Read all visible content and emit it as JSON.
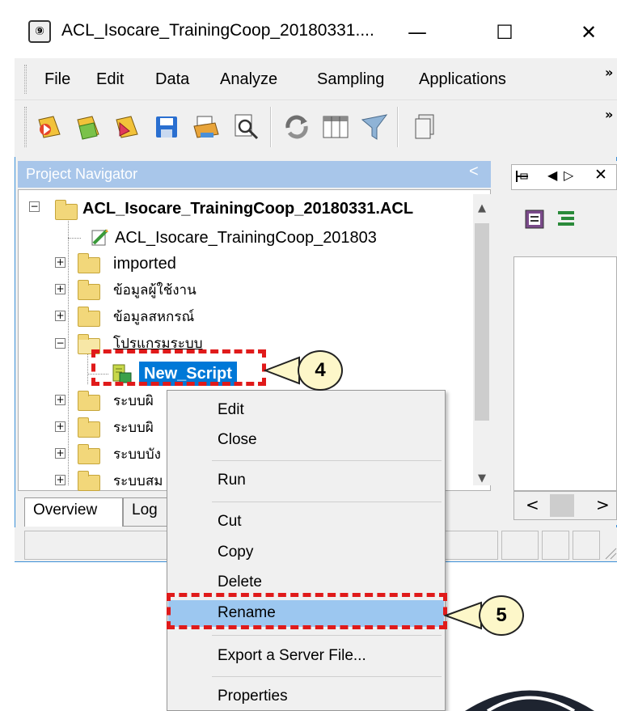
{
  "window": {
    "title": "ACL_Isocare_TrainingCoop_20180331....",
    "minimize": "—",
    "maximize": "☐",
    "close": "✕"
  },
  "menubar": {
    "items": [
      "File",
      "Edit",
      "Data",
      "Analyze",
      "Sampling",
      "Applications"
    ],
    "overflow": "»"
  },
  "toolbar": {
    "icons": [
      "open-project-icon",
      "open-table-icon",
      "open-script-icon",
      "save-icon",
      "print-icon",
      "find-icon",
      "refresh-icon",
      "table-layout-icon",
      "filter-icon",
      "copy-icon"
    ],
    "overflow": "»"
  },
  "navigator": {
    "header": "Project Navigator",
    "collapse": "<",
    "project": "ACL_Isocare_TrainingCoop_20180331.ACL",
    "log": "ACL_Isocare_TrainingCoop_201803",
    "folders": [
      "imported",
      "ข้อมูลผู้ใช้งาน",
      "ข้อมูลสหกรณ์",
      "โปรแกรมระบบ"
    ],
    "script": "New_Script",
    "folders_after": [
      "ระบบผิ",
      "ระบบผิ",
      "ระบบบัง",
      "ระบบสม"
    ]
  },
  "tabs": [
    "Overview",
    "Log"
  ],
  "right_panel": {
    "nav_left": "◀",
    "nav_right": "▷",
    "close": "✕",
    "scroll_left": "<",
    "scroll_right": ">"
  },
  "context_menu": {
    "items": [
      "Edit",
      "Close",
      "Run",
      "Cut",
      "Copy",
      "Delete",
      "Rename",
      "Export a Server File...",
      "Properties"
    ]
  },
  "callouts": {
    "step4": "4",
    "step5": "5"
  },
  "colors": {
    "accent": "#3c8fd6",
    "annotation_red": "#e01a1a",
    "selection": "#0078d7",
    "highlight": "#9cc7f0"
  }
}
